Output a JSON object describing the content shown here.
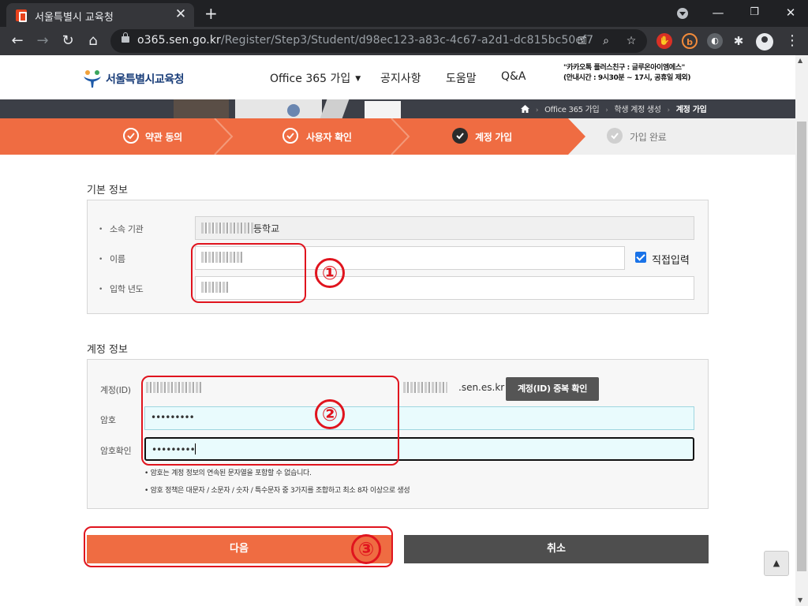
{
  "browser": {
    "tab_title": "서울특별시 교육청",
    "tab_close": "✕",
    "new_tab": "+",
    "url_host": "o365.sen.go.kr",
    "url_path": "/Register/Step3/Student/d98ec123-a83c-4c67-a2d1-dc815bc50ef7",
    "icons": [
      "back-icon",
      "forward-icon",
      "reload-icon",
      "home-icon",
      "lock-icon",
      "key-icon",
      "zoom-icon",
      "star-icon",
      "extension-icon",
      "profile-icon",
      "menu-icon"
    ]
  },
  "header": {
    "logo_text": "서울특별시교육청",
    "nav": [
      {
        "label": "Office 365 가입"
      },
      {
        "label": "공지사항"
      },
      {
        "label": "도움말"
      },
      {
        "label": "Q&A"
      }
    ],
    "kakao_line1": "\"카카오톡 플러스친구 : 글루온아이엠에스\"",
    "kakao_line2": "(안내시간 : 9시30분 ~ 17시, 공휴일 제외)"
  },
  "breadcrumb": [
    "Office 365 가입",
    "학생 계정 생성",
    "계정 가입"
  ],
  "steps": [
    {
      "label": "약관 동의",
      "state": "done"
    },
    {
      "label": "사용자 확인",
      "state": "done"
    },
    {
      "label": "계정 가입",
      "state": "current"
    },
    {
      "label": "가입 완료",
      "state": "pending"
    }
  ],
  "colors": {
    "accent": "#ef6c42",
    "dark_button": "#4e4e4e",
    "annotation": "#e0141e",
    "input_highlight": "#e9fbfd"
  },
  "basic_info": {
    "title": "기본 정보",
    "org_label": "소속 기관",
    "org_value_suffix": "등학교",
    "name_label": "이름",
    "year_label": "입학 년도",
    "direct_input_label": "직접입력",
    "direct_input_checked": true
  },
  "account_info": {
    "title": "계정 정보",
    "id_label": "계정(ID)",
    "id_domain": ".sen.es.kr",
    "dup_check_button": "계정(ID) 중복 확인",
    "password_label": "암호",
    "password_value": "•••••••••",
    "confirm_label": "암호확인",
    "confirm_value": "•••••••••",
    "note1": "• 암호는 계정 정보의 연속된 문자열을 포함할 수 없습니다.",
    "note2": "• 암호 정책은 대문자 / 소문자 / 숫자 / 특수문자 중 3가지를 조합하고 최소 8자 이상으로 생성"
  },
  "buttons": {
    "next": "다음",
    "cancel": "취소",
    "top": "▲"
  },
  "annotations": [
    "①",
    "②",
    "③"
  ]
}
